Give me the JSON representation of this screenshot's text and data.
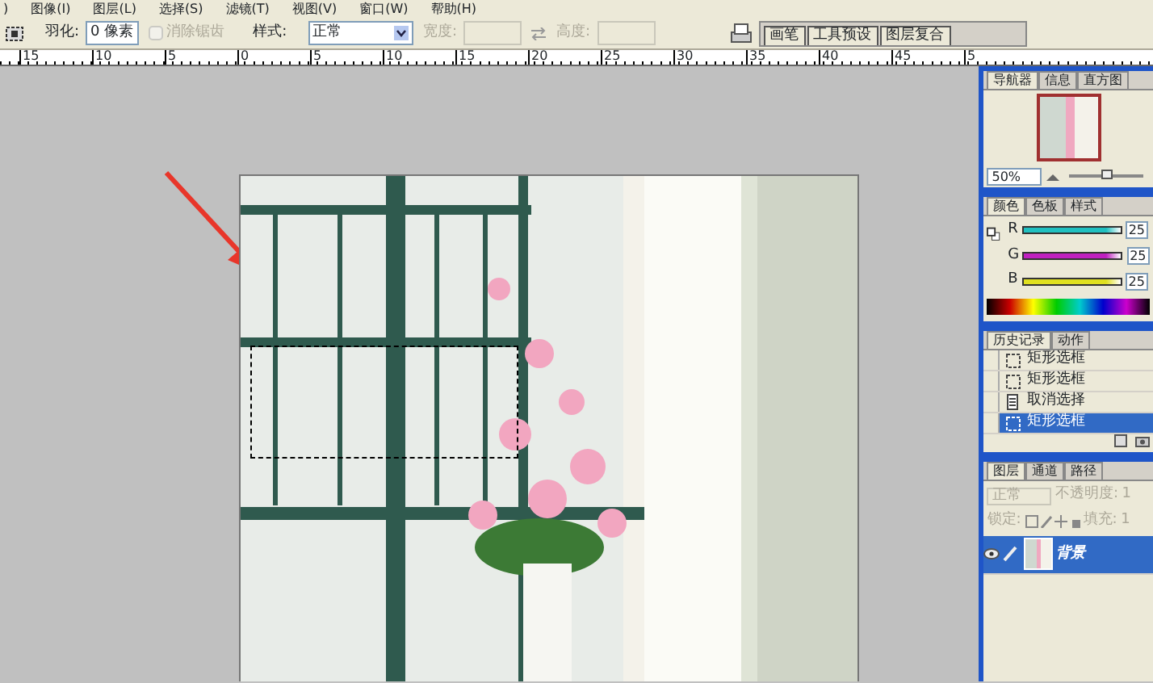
{
  "menu": [
    ")",
    "图像(I)",
    "图层(L)",
    "选择(S)",
    "滤镜(T)",
    "视图(V)",
    "窗口(W)",
    "帮助(H)"
  ],
  "options_bar": {
    "feather_label": "羽化:",
    "feather_value": "0 像素",
    "antialias": {
      "label": "消除锯齿",
      "checked": false,
      "disabled": true
    },
    "style_label": "样式:",
    "style_value": "正常",
    "width_label": "宽度:",
    "height_label": "高度:",
    "fields_disabled": true
  },
  "palette_well": [
    {
      "label": "画笔"
    },
    {
      "label": "工具预设"
    },
    {
      "label": "图层复合"
    }
  ],
  "ruler": [
    "15",
    "10",
    "5",
    "0",
    "5",
    "10",
    "15",
    "20",
    "25",
    "30",
    "35",
    "40",
    "45",
    "5"
  ],
  "canvas": {
    "selection_visible": true
  },
  "navigator": {
    "tabs": [
      {
        "label": "导航器",
        "selected": true
      },
      {
        "label": "信息",
        "selected": false
      },
      {
        "label": "直方图",
        "selected": false
      }
    ],
    "zoom": "50%",
    "level": 0.5
  },
  "color": {
    "tabs": [
      {
        "label": "颜色",
        "selected": true
      },
      {
        "label": "色板",
        "selected": false
      },
      {
        "label": "样式",
        "selected": false
      }
    ],
    "channels": [
      {
        "name": "R",
        "value": "25",
        "level": 1,
        "color": "#20c0c0"
      },
      {
        "name": "G",
        "value": "25",
        "level": 1,
        "color": "#c020c0"
      },
      {
        "name": "B",
        "value": "25",
        "level": 1,
        "color": "#e0e020"
      }
    ]
  },
  "history": {
    "tabs": [
      {
        "label": "历史记录",
        "selected": true
      },
      {
        "label": "动作",
        "selected": false
      }
    ],
    "items": [
      {
        "label": "矩形选框",
        "kind": "marquee",
        "selected": false
      },
      {
        "label": "矩形选框",
        "kind": "marquee",
        "selected": false
      },
      {
        "label": "取消选择",
        "kind": "deselect",
        "selected": false
      },
      {
        "label": "矩形选框",
        "kind": "marquee",
        "selected": true
      }
    ]
  },
  "layers": {
    "tabs": [
      {
        "label": "图层",
        "selected": true
      },
      {
        "label": "通道",
        "selected": false
      },
      {
        "label": "路径",
        "selected": false
      }
    ],
    "blend_mode": "正常",
    "opacity_label": "不透明度:",
    "opacity_value": "1",
    "lock_label": "锁定:",
    "fill_label": "填充:",
    "fill_value": "1",
    "items": [
      {
        "name": "背景",
        "selected": true
      }
    ]
  }
}
